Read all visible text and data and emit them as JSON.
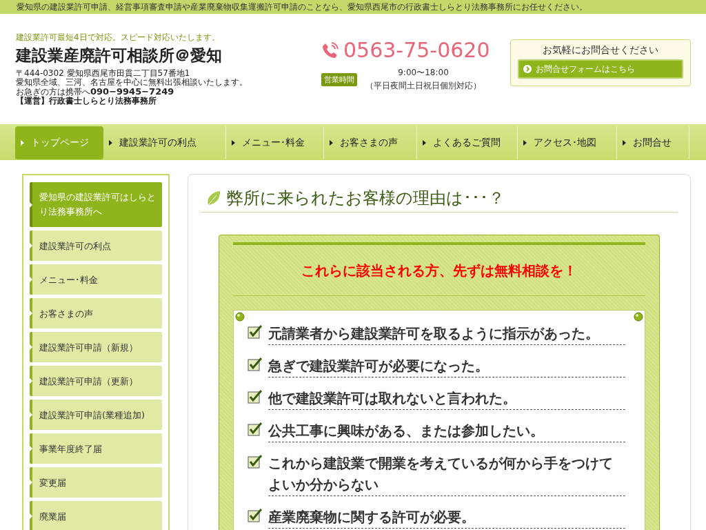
{
  "top_notice": "愛知県の建設業許可申請、経営事項審査申請や産業廃棄物収集運搬許可申請のことなら、愛知県西尾市の行政書士しらとり法務事務所にお任せください。",
  "header": {
    "tagline": "建設業許可最短4日で対応。スピード対応いたします。",
    "site_title": "建設業産廃許可相談所＠愛知",
    "address_lines": [
      "〒444-0302 愛知県西尾市田貫二丁目57番地1",
      "愛知県全域、三河、名古屋を中心に無料出張相談いたします。"
    ],
    "mobile_line": "お急ぎの方は携帯へ**090−9945−7249**",
    "operator": "【運営】行政書士しらとり法務事務所",
    "phone": "0563-75-0620",
    "hours_badge": "営業時間",
    "hours": "9:00〜18:00",
    "hours_note": "（平日夜間土日祝日個別対応）",
    "contact_title": "お気軽にお問合せください",
    "contact_button": "お問合せフォームはこちら"
  },
  "nav": [
    {
      "label": "トップページ",
      "selected": true
    },
    {
      "label": "建設業許可の利点",
      "selected": false
    },
    {
      "label": "メニュー･料金",
      "selected": false
    },
    {
      "label": "お客さまの声",
      "selected": false
    },
    {
      "label": "よくあるご質問",
      "selected": false
    },
    {
      "label": "アクセス･地図",
      "selected": false
    },
    {
      "label": "お問合せ",
      "selected": false
    }
  ],
  "sidebar": [
    {
      "label": "愛知県の建設業許可はしらとり法務事務所へ",
      "selected": true
    },
    {
      "label": "建設業許可の利点",
      "selected": false
    },
    {
      "label": "メニュー･料金",
      "selected": false
    },
    {
      "label": "お客さまの声",
      "selected": false
    },
    {
      "label": "建設業許可申請（新規）",
      "selected": false
    },
    {
      "label": "建設業許可申請（更新）",
      "selected": false
    },
    {
      "label": "建設業許可申請(業種追加)",
      "selected": false
    },
    {
      "label": "事業年度終了届",
      "selected": false
    },
    {
      "label": "変更届",
      "selected": false
    },
    {
      "label": "廃業届",
      "selected": false
    }
  ],
  "main": {
    "heading": "弊所に来られたお客様の理由は･･･？",
    "callout": "これらに該当される方、先ずは無料相談を！",
    "checklist": [
      "元請業者から建設業許可を取るように指示があった。",
      "急ぎで建設業許可が必要になった。",
      "他で建設業許可は取れないと言われた。",
      "公共工事に興味がある、または参加したい。",
      "これから建設業で開業を考えているが何から手をつけてよいか分からない",
      "産業廃棄物に関する許可が必要。"
    ]
  }
}
